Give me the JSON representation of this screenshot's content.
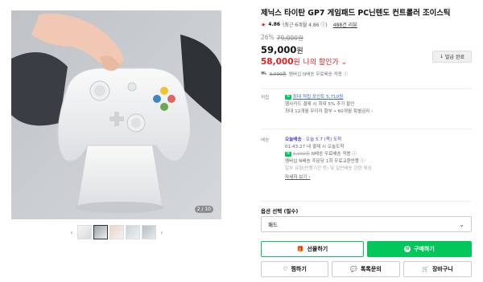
{
  "gallery": {
    "counter": "2 / 10",
    "prev_arrow": "‹",
    "next_arrow": "›",
    "thumb_count": 5
  },
  "product": {
    "title": "제닉스 타이탄 GP7 게임패드 PC닌텐도 컨트롤러 조이스틱",
    "rating": "4.86",
    "rating_detail": "(최근 6개월 4.86 ⓘ)",
    "review_link": "488건 리뷰"
  },
  "price": {
    "discount_rate": "26%",
    "original": "79,000원",
    "sale_value": "59,000",
    "sale_won": "원",
    "my_price_value": "58,000",
    "my_price_won": "원",
    "my_price_label": "나의 할인가 ⌄"
  },
  "coupon": {
    "label": "발급 완료",
    "icon": "↓"
  },
  "shipping_note": {
    "struck": "3,000원",
    "text": "멤버십 N배송 무료배송 적용 ⓘ"
  },
  "points": {
    "label": "적립",
    "link": "최대 적립 포인트 5,710원",
    "line1": "행사카드 결제 시 최대 5% 추가 할인",
    "line2": "최대 12개월 무이자 할부 • 60개월 특별금리 ›"
  },
  "delivery": {
    "label": "배송",
    "badge": "오늘배송",
    "arrive": "· 오늘 5.7 (목) 도착",
    "line2": "01:43:27 내 결제 시 오늘도착",
    "line3_struck": "3,000원",
    "line3": "N배송 무료배송 적용 ⓘ",
    "line4": "멤버십 N배송 주문당 1회 무료교환반품 ⓘ",
    "line5": "일부 유형(반품기간 등) 및 일반배송 관련 제외",
    "detail_link": "자세히 보기 ›"
  },
  "option": {
    "label": "옵션 선택 (필수)",
    "selected": "패드",
    "chevron": "⌄"
  },
  "buttons": {
    "gift": "선물하기",
    "buy": "구매하기",
    "wish": "찜하기",
    "talk": "톡톡문의",
    "cart": "장바구니"
  },
  "colors": {
    "naver_green": "#03c75a",
    "sale_red": "#e02020",
    "link_blue": "#3865c9",
    "today_purple": "#4b3fc6"
  },
  "icons": {
    "gift": "gift-icon",
    "buy": "naver-pay-icon",
    "wish": "heart-icon",
    "talk": "chat-icon",
    "cart": "cart-icon",
    "star": "star-icon",
    "truck": "truck-icon"
  }
}
